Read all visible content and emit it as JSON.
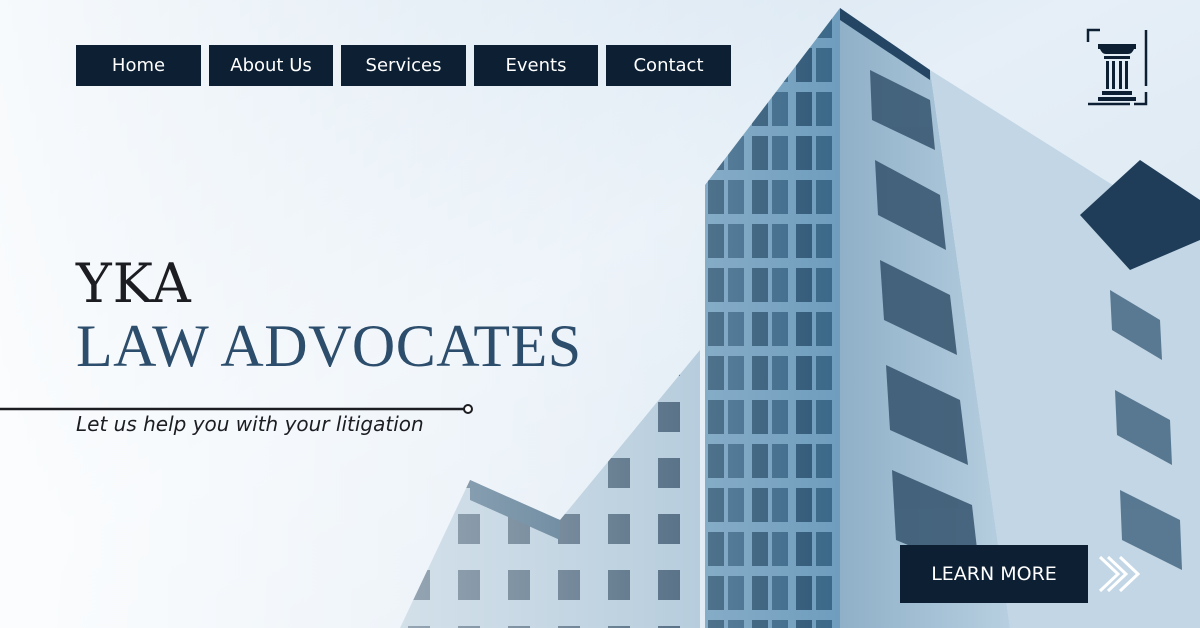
{
  "nav": {
    "items": [
      {
        "label": "Home"
      },
      {
        "label": "About Us"
      },
      {
        "label": "Services"
      },
      {
        "label": "Events"
      },
      {
        "label": "Contact"
      }
    ]
  },
  "hero": {
    "name": "YKA",
    "subtitle": "LAW ADVOCATES",
    "tagline": "Let us help you with your litigation"
  },
  "cta": {
    "label": "LEARN MORE",
    "icon": "double-chevron-right-icon"
  },
  "logo": {
    "icon": "pillar-icon"
  },
  "colors": {
    "navy": "#0c1f33",
    "accent": "#2c4d6b",
    "text": "#1c1d22"
  }
}
